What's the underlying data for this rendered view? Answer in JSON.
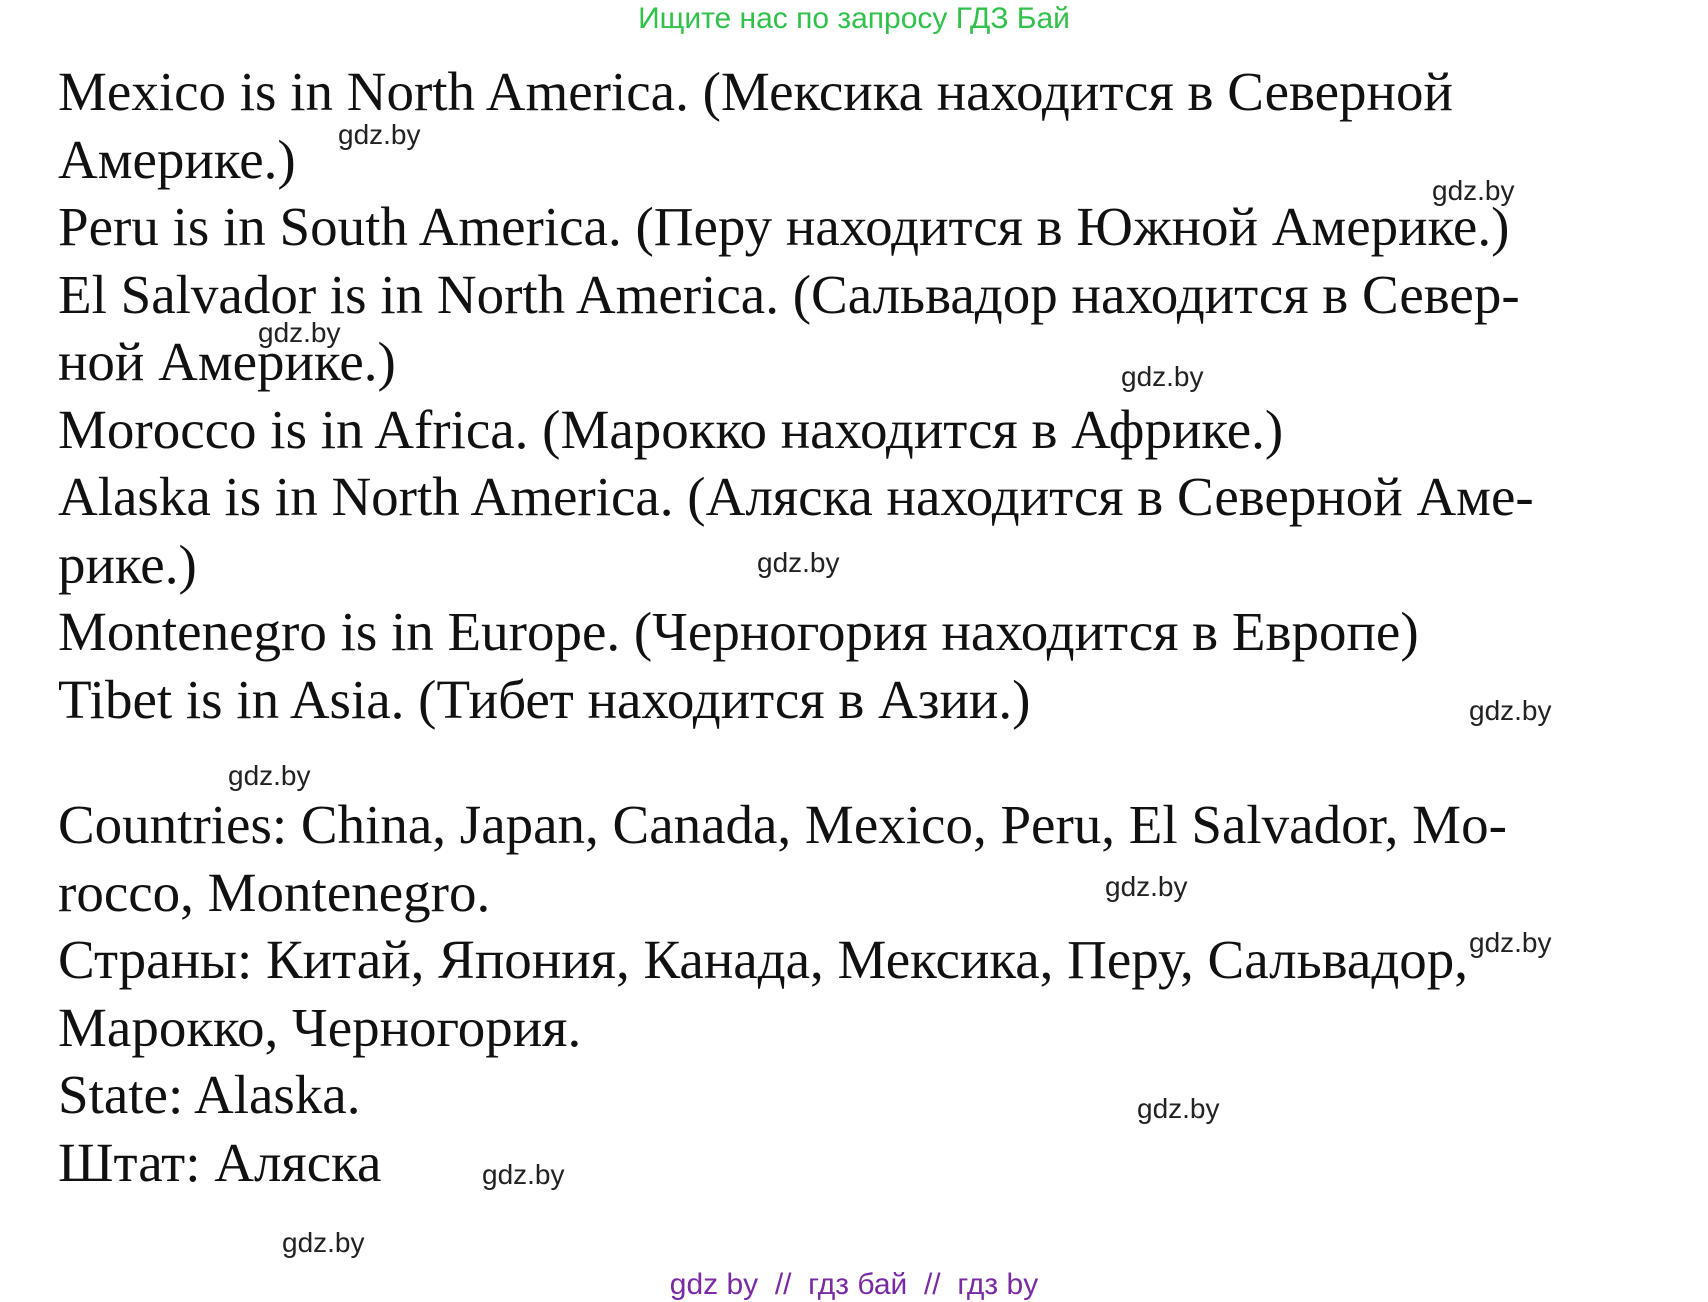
{
  "header": {
    "text": "Ищите нас по запросу ГДЗ Бай",
    "color": "#2fc14a"
  },
  "lines_part1": [
    "Mexico is in North America. (Мексика находится в Северной",
    "Америке.)",
    "Peru is in South America. (Перу находится в Южной Америке.)",
    "El Salvador is in North America. (Сальвадор находится в Север-",
    "ной Америке.)",
    "Morocco is in Africa. (Марокко находится в Африке.)",
    "Alaska is in North America. (Аляска находится в Северной Аме-",
    "рике.)",
    "Montenegro is in Europe. (Черногория находится в Европе)",
    "Tibet is in Asia. (Тибет находится в Азии.)"
  ],
  "lines_part2": [
    "Countries: China, Japan, Canada, Mexico, Peru, El Salvador, Mo-",
    "rocco, Montenegro.",
    "Страны: Китай, Япония, Канада, Мексика, Перу, Сальвадор,",
    "Марокко, Черногория.",
    "State: Alaska.",
    "Штат: Аляска"
  ],
  "watermarks": [
    "gdz.by",
    "gdz.by",
    "gdz.by",
    "gdz.by",
    "gdz.by",
    "gdz.by",
    "gdz.by",
    "gdz.by",
    "gdz.by",
    "gdz.by",
    "gdz.by",
    "gdz.by"
  ],
  "footer": {
    "text": "gdz by  //  гдз бай  //  гдз by",
    "color": "#7a2aa3"
  }
}
